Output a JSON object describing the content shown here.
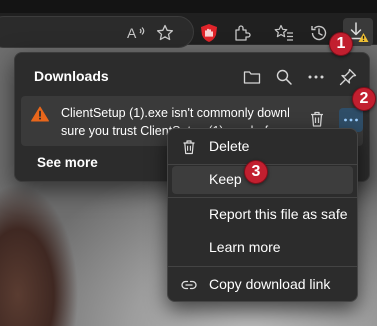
{
  "toolbar": {
    "icons": [
      "read-aloud-icon",
      "favorite-star-icon",
      "extension-icon",
      "puzzle-icon",
      "favorites-icon",
      "history-icon",
      "downloads-icon"
    ]
  },
  "downloads_panel": {
    "title": "Downloads",
    "header_icons": [
      "open-folder-icon",
      "search-icon",
      "more-options-icon",
      "pin-icon"
    ],
    "item": {
      "line1": "ClientSetup (1).exe isn't commonly downloaded",
      "line2": "sure you trust ClientSetup (1).exe before"
    },
    "see_more": "See more"
  },
  "context_menu": {
    "items": [
      {
        "label": "Delete",
        "icon": "trash-icon"
      },
      {
        "label": "Keep",
        "icon": ""
      },
      {
        "label": "Report this file as safe",
        "icon": ""
      },
      {
        "label": "Learn more",
        "icon": ""
      },
      {
        "label": "Copy download link",
        "icon": "link-icon"
      }
    ]
  },
  "badges": [
    "1",
    "2",
    "3"
  ],
  "colors": {
    "accent_blue": "#2f4e68",
    "badge_red": "#c21f2f",
    "warning_orange": "#e8661b",
    "warn_yellow": "#f2c233"
  }
}
